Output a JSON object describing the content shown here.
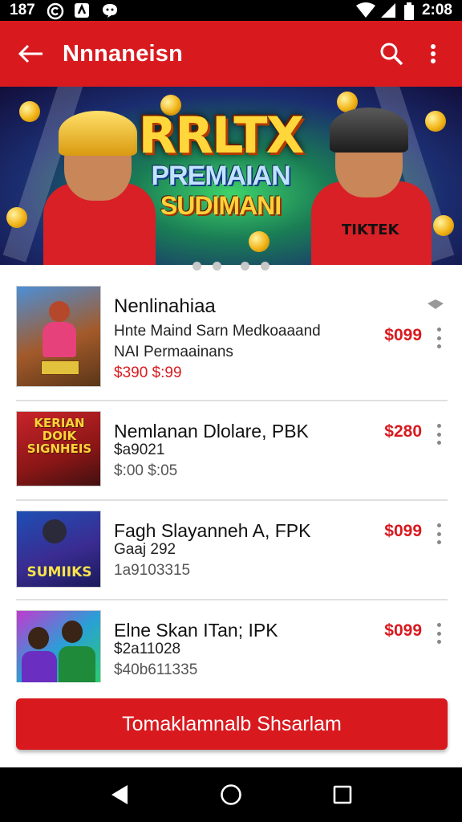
{
  "status_bar": {
    "left_text": "187",
    "time": "2:08",
    "icons": [
      "copyright-icon",
      "app-notification-icon",
      "chat-icon",
      "wifi-icon",
      "signal-icon",
      "battery-icon"
    ]
  },
  "app_bar": {
    "title": "Nnnaneisn",
    "back_icon": "arrow-back-icon",
    "search_icon": "search-icon",
    "more_icon": "more-vert-icon",
    "color": "#d81a1f"
  },
  "banner": {
    "line1": "RRLTX",
    "line2": "PREMAIAN",
    "line3": "SUDIMANI",
    "shirt_text": "TIKTEK",
    "dots": 4
  },
  "items": [
    {
      "name": "Nenlinahiaa",
      "line1": "Hnte Maind Sarn Medkoaaand",
      "line2": "NAI Permaainans",
      "line3": "$390 $:99",
      "price": "$099",
      "has_fav": true,
      "thumb_text": ""
    },
    {
      "name": "Nemlanan Dlolare, PBK",
      "line1": "$a9021",
      "line2": "$:00 $:05",
      "line3": "",
      "price": "$280",
      "has_fav": false,
      "thumb_text": "KERIAN DOIK SIGNHEIS"
    },
    {
      "name": "Fagh Slayanneh A, FPK",
      "line1": "Gaaj 292",
      "line2": "1a9103315",
      "line3": "",
      "price": "$099",
      "has_fav": false,
      "thumb_text": "SUMIIKS"
    },
    {
      "name": "Elne Skan ITan; IPK",
      "line1": "$2a11028",
      "line2": "$40b611335",
      "line3": "",
      "price": "$099",
      "has_fav": false,
      "thumb_text": ""
    }
  ],
  "cta": {
    "label": "Tomaklamnalb Shsarlam"
  },
  "nav": {
    "back_icon": "triangle-back-icon",
    "home_icon": "circle-home-icon",
    "recents_icon": "square-recents-icon"
  }
}
